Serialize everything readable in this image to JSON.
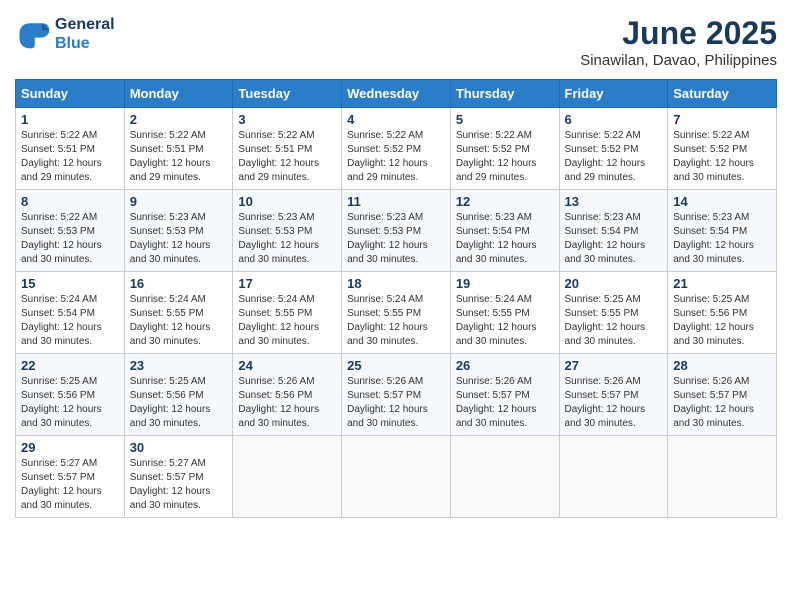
{
  "header": {
    "logo_line1": "General",
    "logo_line2": "Blue",
    "title": "June 2025",
    "subtitle": "Sinawilan, Davao, Philippines"
  },
  "calendar": {
    "days_of_week": [
      "Sunday",
      "Monday",
      "Tuesday",
      "Wednesday",
      "Thursday",
      "Friday",
      "Saturday"
    ],
    "weeks": [
      [
        null,
        null,
        null,
        null,
        null,
        null,
        null
      ]
    ],
    "cells": [
      {
        "day": null
      },
      {
        "day": null
      },
      {
        "day": null
      },
      {
        "day": null
      },
      {
        "day": null
      },
      {
        "day": null
      },
      {
        "day": null
      }
    ]
  }
}
